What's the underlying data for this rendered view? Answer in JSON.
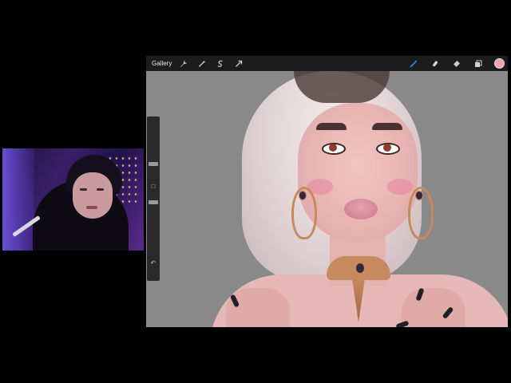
{
  "toolbar": {
    "gallery_label": "Gallery",
    "left_tools": [
      {
        "icon": "wrench-icon"
      },
      {
        "icon": "magic-wand-icon"
      },
      {
        "icon": "selection-icon"
      },
      {
        "icon": "transform-arrow-icon"
      }
    ],
    "right_tools": [
      {
        "icon": "brush-icon",
        "active": true
      },
      {
        "icon": "smudge-icon"
      },
      {
        "icon": "eraser-icon"
      },
      {
        "icon": "layers-icon"
      }
    ],
    "current_color": "#f2a5a5",
    "active_color": "#3b82f6"
  },
  "side_panel": {
    "undo_glyph": "↶",
    "modify_glyph": "□"
  }
}
